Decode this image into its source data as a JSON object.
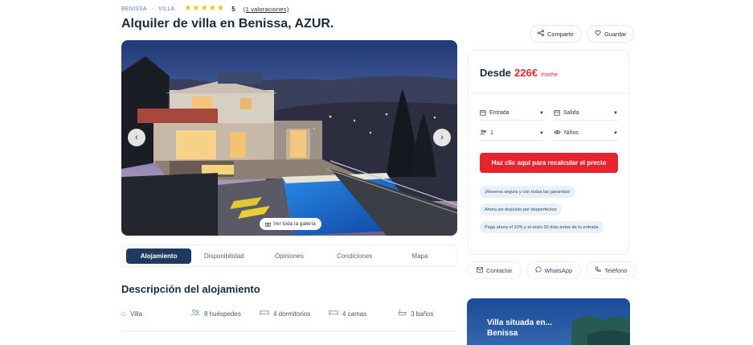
{
  "breadcrumb": {
    "part1": "BENISSA",
    "sep": "-",
    "part2": "VILLA"
  },
  "rating": {
    "stars": 5,
    "score": "5",
    "count_label": "(1 valoraciones)"
  },
  "title": "Alquiler de villa en Benissa, AZUR.",
  "actions": {
    "share": "Compartir",
    "save": "Guardar"
  },
  "gallery": {
    "view_all": "Ver toda la galería"
  },
  "tabs": [
    "Alojamiento",
    "Disponibilidad",
    "Opiniones",
    "Condiciones",
    "Mapa"
  ],
  "description": {
    "title": "Descripción del alojamiento",
    "features": [
      {
        "icon": "house-icon",
        "label": "Villa"
      },
      {
        "icon": "people-icon",
        "label": "8 huéspedes"
      },
      {
        "icon": "bed-icon",
        "label": "4 dormitorios"
      },
      {
        "icon": "bed-icon",
        "label": "4 camas"
      },
      {
        "icon": "bath-icon",
        "label": "3 baños"
      }
    ]
  },
  "booking": {
    "from_label": "Desde",
    "price": "226€",
    "unit": "/noche",
    "checkin": "Entrada",
    "checkout": "Salida",
    "guests": "1",
    "children": "Niños",
    "cta": "Haz clic aquí para recalcular el precio",
    "chips": [
      "¡Reserva segura y con todas las garantías!",
      "Ahora sin depósito por desperfectos",
      "Paga ahora el 10% y el resto 30 días antes de tu entrada"
    ]
  },
  "contact": {
    "contact": "Contactar",
    "whatsapp": "WhatsApp",
    "phone": "Teléfono"
  },
  "promo": {
    "text": "Villa situada en... Benissa"
  },
  "colors": {
    "navy": "#1e3a5f",
    "red": "#e3262f",
    "star": "#f4c20d"
  }
}
